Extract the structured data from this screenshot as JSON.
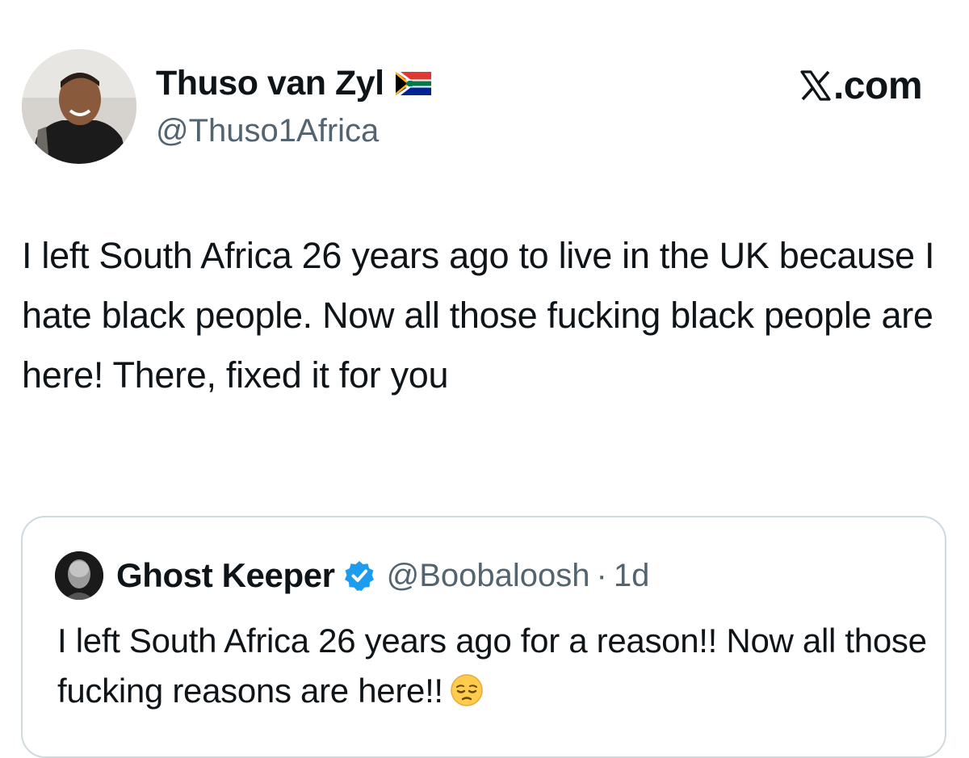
{
  "author": {
    "display_name": "Thuso van Zyl",
    "handle": "@Thuso1Africa",
    "flag_icon": "south-africa-flag-icon"
  },
  "brand": {
    "logo_icon": "x-logo-icon",
    "domain": ".com"
  },
  "tweet": {
    "text": "I left South Africa 26 years ago to live in the UK because I hate black people. Now all those fucking black people are here! There, fixed it for you"
  },
  "quoted_tweet": {
    "display_name": "Ghost Keeper",
    "verified_icon": "verified-badge-icon",
    "handle": "@Boobaloosh",
    "separator": "·",
    "time": "1d",
    "text": "I left South Africa 26 years ago for a reason!! Now all those fucking reasons are here!!",
    "emoji": "pensive-face-emoji"
  },
  "colors": {
    "text": "#0f1419",
    "secondary": "#536471",
    "verified": "#1d9bf0",
    "border": "#cfd9de"
  }
}
